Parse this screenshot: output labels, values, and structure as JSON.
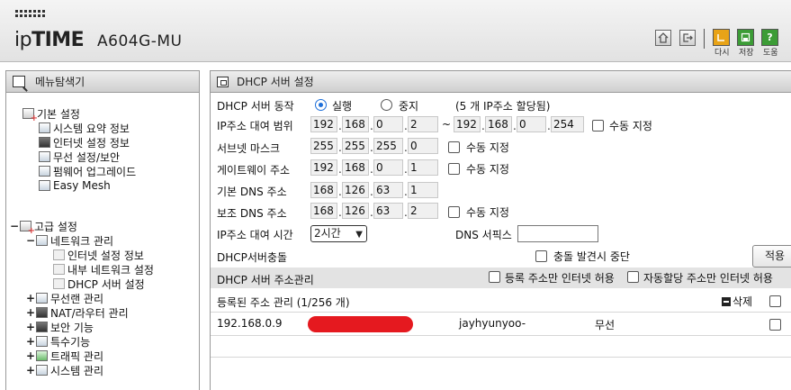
{
  "header": {
    "brand_light": "ip",
    "brand_bold": "TIME",
    "model": "A604G-MU",
    "toolbar": {
      "home_icon": "home-icon",
      "logout_icon": "logout-icon",
      "next_label": "다시",
      "save_label": "저장",
      "help_label": "도움",
      "help_glyph": "?"
    }
  },
  "menu": {
    "title": "메뉴탐색기",
    "basic": {
      "label": "기본 설정",
      "items": [
        "시스템 요약 정보",
        "인터넷 설정 정보",
        "무선 설정/보안",
        "펌웨어 업그레이드",
        "Easy Mesh"
      ]
    },
    "advanced": {
      "label": "고급 설정",
      "network": {
        "label": "네트워크 관리",
        "items": [
          "인터넷 설정 정보",
          "내부 네트워크 설정",
          "DHCP 서버 설정"
        ]
      },
      "items": [
        "무선랜 관리",
        "NAT/라우터 관리",
        "보안 기능",
        "특수기능",
        "트래픽 관리",
        "시스템 관리"
      ]
    }
  },
  "panel": {
    "title": "DHCP 서버 설정",
    "server_action": {
      "label": "DHCP 서버 동작",
      "option_run": "실행",
      "option_stop": "중지",
      "selected": "실행",
      "note": "(5 개 IP주소 할당됨)"
    },
    "ip_range": {
      "label": "IP주소 대여 범위",
      "start": [
        "192",
        "168",
        "0",
        "2"
      ],
      "tilde": "~",
      "end": [
        "192",
        "168",
        "0",
        "254"
      ],
      "manual": "수동 지정"
    },
    "subnet": {
      "label": "서브넷 마스크",
      "value": [
        "255",
        "255",
        "255",
        "0"
      ],
      "manual": "수동 지정"
    },
    "gateway": {
      "label": "게이트웨이 주소",
      "value": [
        "192",
        "168",
        "0",
        "1"
      ],
      "manual": "수동 지정"
    },
    "dns1": {
      "label": "기본 DNS 주소",
      "value": [
        "168",
        "126",
        "63",
        "1"
      ]
    },
    "dns2": {
      "label": "보조 DNS 주소",
      "value": [
        "168",
        "126",
        "63",
        "2"
      ],
      "manual": "수동 지정"
    },
    "lease": {
      "label": "IP주소 대여 시간",
      "value": "2시간",
      "dns_suffix_label": "DNS 서픽스",
      "dns_suffix_value": ""
    },
    "conflict": {
      "label": "DHCP서버충돌",
      "checkbox_label": "충돌 발견시 중단"
    },
    "apply_label": "적용",
    "address_mgmt": {
      "title": "DHCP 서버 주소관리",
      "internet_only_registered": "등록 주소만 인터넷 허용",
      "internet_only_auto": "자동할당 주소만 인터넷 허용",
      "registered_label": "등록된 주소 관리 (1/256 개)",
      "delete_label": "삭제",
      "rows": [
        {
          "ip": "192.168.0.9",
          "name": "jayhyunyoo-",
          "type": "무선"
        }
      ]
    }
  },
  "colors": {
    "radio_selected": "#1e6fd9",
    "redaction": "#e5191f",
    "toolbar_orange": "#e8a317",
    "toolbar_green": "#3c9c36"
  }
}
